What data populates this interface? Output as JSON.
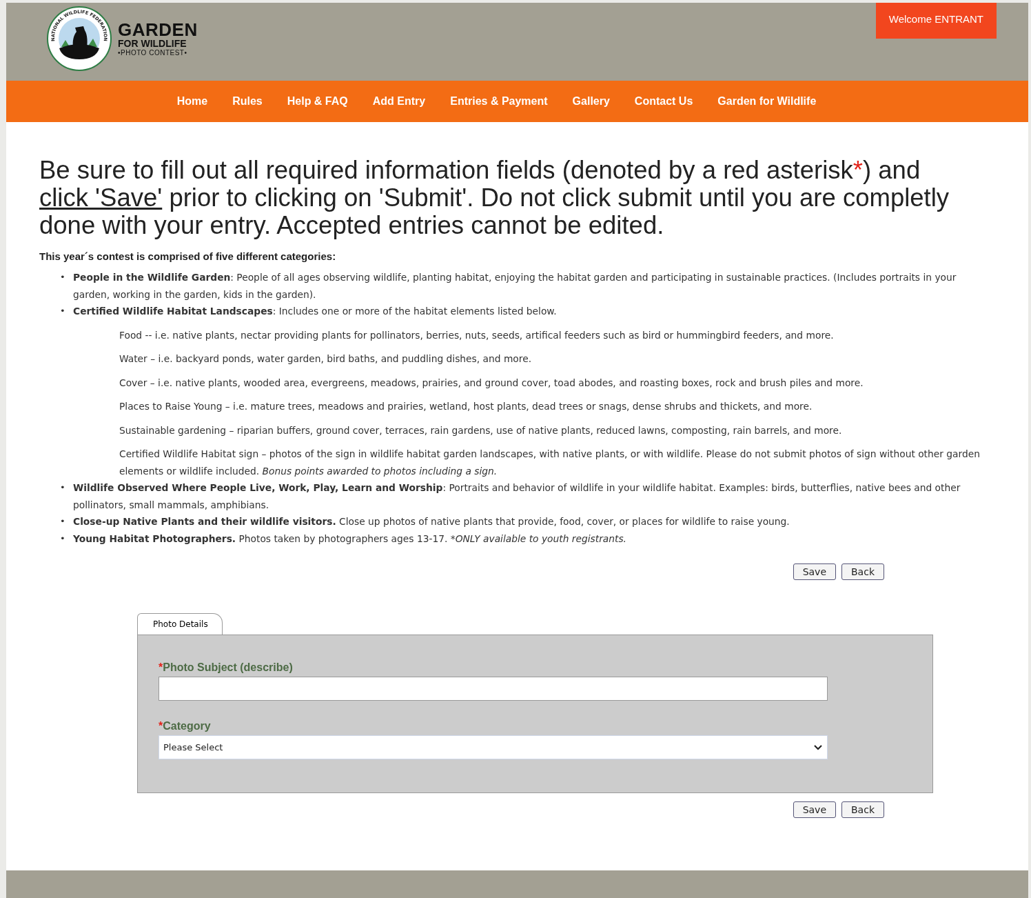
{
  "header": {
    "logo": {
      "ring_text": "NATIONAL WILDLIFE FEDERATION",
      "title": "GARDEN",
      "subtitle": "FOR WILDLIFE",
      "tagline": "•PHOTO CONTEST•"
    },
    "welcome": "Welcome ENTRANT"
  },
  "nav": [
    {
      "label": "Home"
    },
    {
      "label": "Rules"
    },
    {
      "label": "Help & FAQ"
    },
    {
      "label": "Add Entry"
    },
    {
      "label": "Entries & Payment"
    },
    {
      "label": "Gallery"
    },
    {
      "label": "Contact Us"
    },
    {
      "label": "Garden for Wildlife"
    }
  ],
  "notice": [
    {
      "kind": "text",
      "text": "Be sure to fill out all required information fields (denoted by a red asterisk"
    },
    {
      "kind": "required",
      "text": "*"
    },
    {
      "kind": "text",
      "text": ") and "
    },
    {
      "kind": "link",
      "text": "click 'Save'"
    },
    {
      "kind": "text",
      "text": " prior to clicking on 'Submit'. Do not click submit until you are completly done with your entry. Accepted entries cannot be edited."
    }
  ],
  "intro": "This year´s contest is comprised of five different categories:",
  "categories": [
    {
      "marker": "•",
      "text": "**People in the Wildlife Garden**: People of all ages observing wildlife, planting habitat, enjoying the habitat garden and participating in sustainable practices. (Includes portraits in your garden, working in the garden, kids in the garden)."
    },
    {
      "marker": "•",
      "text": "**Certified Wildlife Habitat Landscapes**: Includes one or more of the habitat elements listed below.",
      "elements": [
        {
          "text": "Food -- i.e. native plants, nectar providing plants for pollinators, berries, nuts, seeds, artifical feeders such as bird or hummingbird feeders, and more."
        },
        {
          "text": "Water – i.e. backyard ponds, water garden, bird baths, and puddling dishes, and more."
        },
        {
          "text": "Cover – i.e. native plants, wooded area, evergreens, meadows, prairies, and ground cover, toad abodes, and roasting boxes, rock and brush piles and more."
        },
        {
          "text": "Places to Raise Young – i.e. mature trees, meadows and prairies, wetland, host plants, dead trees or snags, dense shrubs and thickets, and more."
        },
        {
          "text": "Sustainable gardening – riparian buffers, ground cover, terraces, rain gardens, use of native plants, reduced lawns, composting, rain barrels, and more."
        },
        {
          "text": "Certified Wildlife Habitat sign – photos of the sign in wildlife habitat garden landscapes, with native plants, or with wildlife. Please do not submit photos of sign without other garden elements or wildlife included. ",
          "note": "Bonus points awarded to photos including a sign."
        }
      ]
    },
    {
      "marker": "•",
      "text": "**Wildlife Observed Where People Live, Work, Play, Learn and Worship**: Portraits and behavior of wildlife in your wildlife habitat. Examples: birds, butterflies, native bees and other pollinators, small mammals, amphibians."
    },
    {
      "marker": "•",
      "text": "**Close-up Native Plants and their wildlife visitors.** Close up photos of native plants that provide, food, cover, or places for wildlife to raise young."
    },
    {
      "marker": "•",
      "text": "**Young Habitat Photographers.** Photos taken by photographers ages 13-17. ",
      "note": "*ONLY available to youth registrants."
    }
  ],
  "top_buttons": [
    "Save",
    "Back"
  ],
  "form": {
    "tabs": [
      {
        "label": "Photo Details",
        "selected": true
      }
    ],
    "fields": [
      {
        "kind": "text",
        "label": "Photo Subject (describe)",
        "required": true
      },
      {
        "kind": "select",
        "label": "Category",
        "required": true,
        "value": "Please Select"
      }
    ]
  },
  "bottom_buttons": [
    "Save",
    "Back"
  ]
}
